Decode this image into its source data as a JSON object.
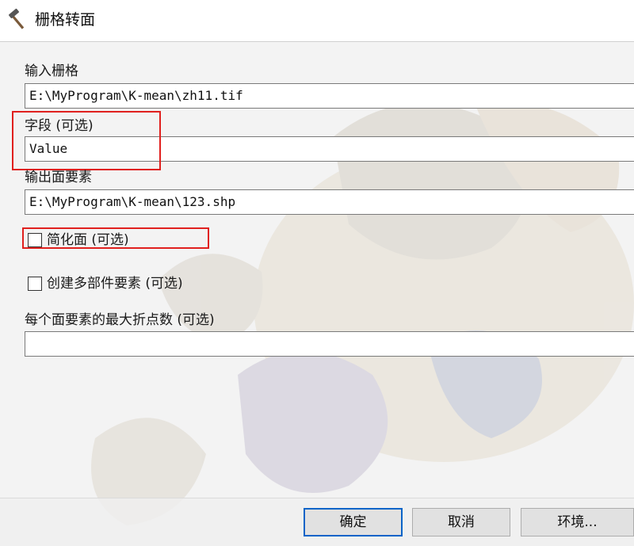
{
  "window": {
    "title": "栅格转面",
    "icon": "hammer-icon"
  },
  "form": {
    "input_raster_label": "输入栅格",
    "input_raster_value": "E:\\MyProgram\\K-mean\\zh11.tif",
    "field_label": "字段 (可选)",
    "field_value": "Value",
    "output_label": "输出面要素",
    "output_value": "E:\\MyProgram\\K-mean\\123.shp",
    "simplify_label": "简化面 (可选)",
    "simplify_checked": false,
    "multipart_label": "创建多部件要素 (可选)",
    "multipart_checked": false,
    "max_vertices_label": "每个面要素的最大折点数 (可选)",
    "max_vertices_value": ""
  },
  "buttons": {
    "ok": "确定",
    "cancel": "取消",
    "environments": "环境..."
  },
  "colors": {
    "highlight": "#e0201e",
    "default_button_border": "#0a64c8"
  }
}
